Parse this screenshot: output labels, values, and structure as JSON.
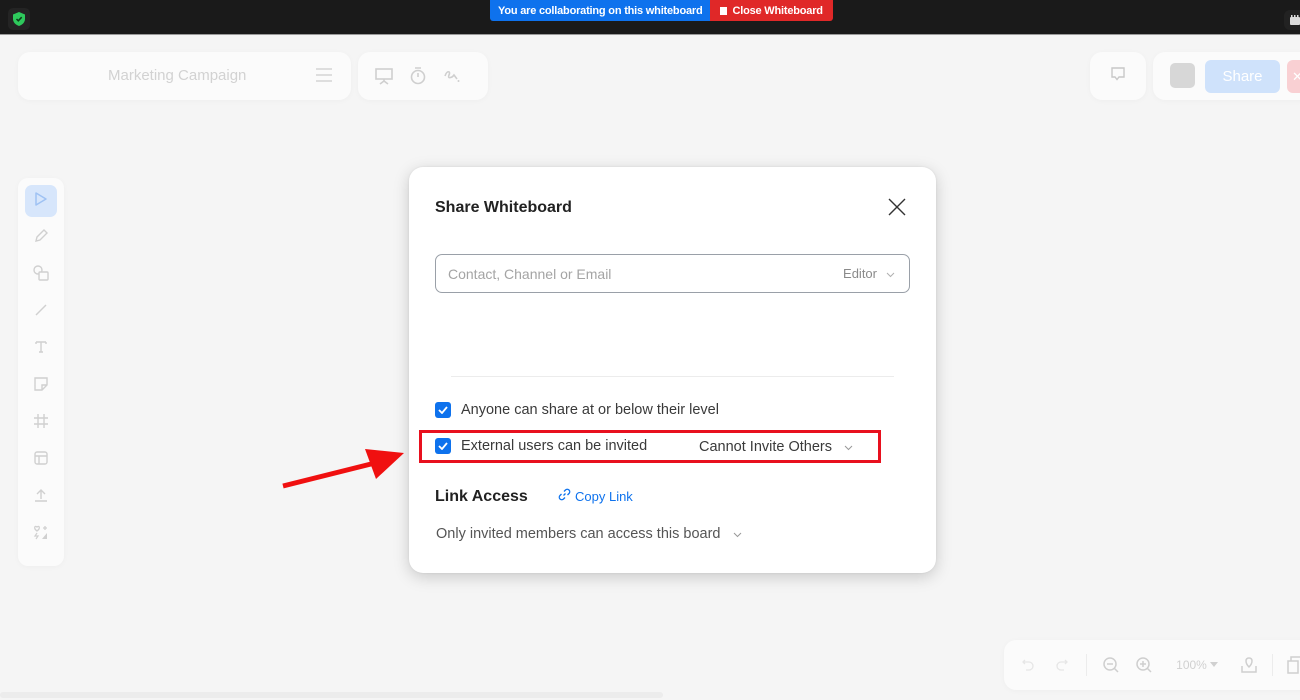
{
  "topbar": {
    "security_icon": "shield-check-icon",
    "banner_message": "You are collaborating on this whiteboard",
    "close_label": "Close Whiteboard",
    "right_icon": "app-window-icon"
  },
  "header": {
    "board_title": "Marketing Campaign",
    "menu_icon": "hamburger-menu-icon",
    "tools": [
      "present-icon",
      "timer-icon",
      "scribble-icon"
    ],
    "comment_icon": "comment-icon",
    "share_label": "Share",
    "close_icon_label": "✕"
  },
  "left_toolbar": {
    "items": [
      {
        "name": "select-tool",
        "icon": "pointer-icon",
        "active": true
      },
      {
        "name": "pen-tool",
        "icon": "pencil-icon"
      },
      {
        "name": "shapes-tool",
        "icon": "shapes-icon"
      },
      {
        "name": "line-tool",
        "icon": "line-icon"
      },
      {
        "name": "text-tool",
        "icon": "text-icon"
      },
      {
        "name": "sticky-note-tool",
        "icon": "sticky-note-icon"
      },
      {
        "name": "frame-tool",
        "icon": "frame-icon"
      },
      {
        "name": "template-tool",
        "icon": "template-icon"
      },
      {
        "name": "upload-tool",
        "icon": "upload-icon"
      },
      {
        "name": "more-tools",
        "icon": "shapes-more-icon"
      }
    ]
  },
  "bottom_bar": {
    "zoom_level": "100%",
    "items": [
      "undo-icon",
      "redo-icon",
      "zoom-out-icon",
      "zoom-in-icon",
      "location-icon",
      "copy-icon"
    ]
  },
  "dialog": {
    "title": "Share Whiteboard",
    "invite_placeholder": "Contact, Channel or Email",
    "invite_value": "",
    "role": "Editor",
    "options": [
      {
        "label": "Anyone can share at or below their level",
        "checked": true
      },
      {
        "label": "External users can be invited",
        "checked": true,
        "permission": "Cannot Invite Others"
      }
    ],
    "link_access_heading": "Link Access",
    "copy_link_label": "Copy Link",
    "access_level": "Only invited members can access this board"
  },
  "colors": {
    "accent": "#0e72ed",
    "danger": "#e02828",
    "annotation": "#e8101e"
  }
}
